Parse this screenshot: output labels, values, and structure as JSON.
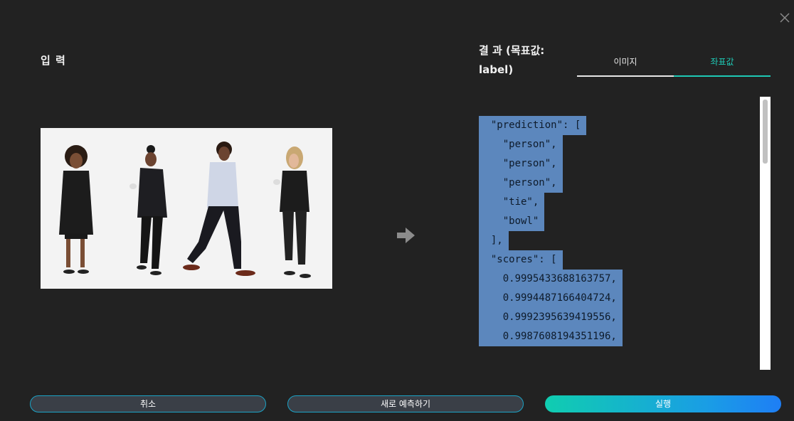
{
  "input": {
    "title": "입 력"
  },
  "result": {
    "title": "결 과 (목표값: label)",
    "tabs": [
      {
        "label": "이미지",
        "active": false
      },
      {
        "label": "좌표값",
        "active": true
      }
    ],
    "json_lines": [
      "  \"prediction\": [",
      "    \"person\",",
      "    \"person\",",
      "    \"person\",",
      "    \"tie\",",
      "    \"bowl\"",
      "  ],",
      "  \"scores\": [",
      "    0.9995433688163757,",
      "    0.9994487166404724,",
      "    0.9992395639419556,",
      "    0.9987608194351196,"
    ]
  },
  "buttons": {
    "cancel": "취소",
    "repredict": "새로 예측하기",
    "run": "실행"
  },
  "colors": {
    "background": "#222222",
    "accent_teal": "#1ec8b4",
    "highlight": "#5c87bd",
    "button_border": "#1ba3c6"
  },
  "icons": [
    "close-icon",
    "arrow-right-icon"
  ]
}
